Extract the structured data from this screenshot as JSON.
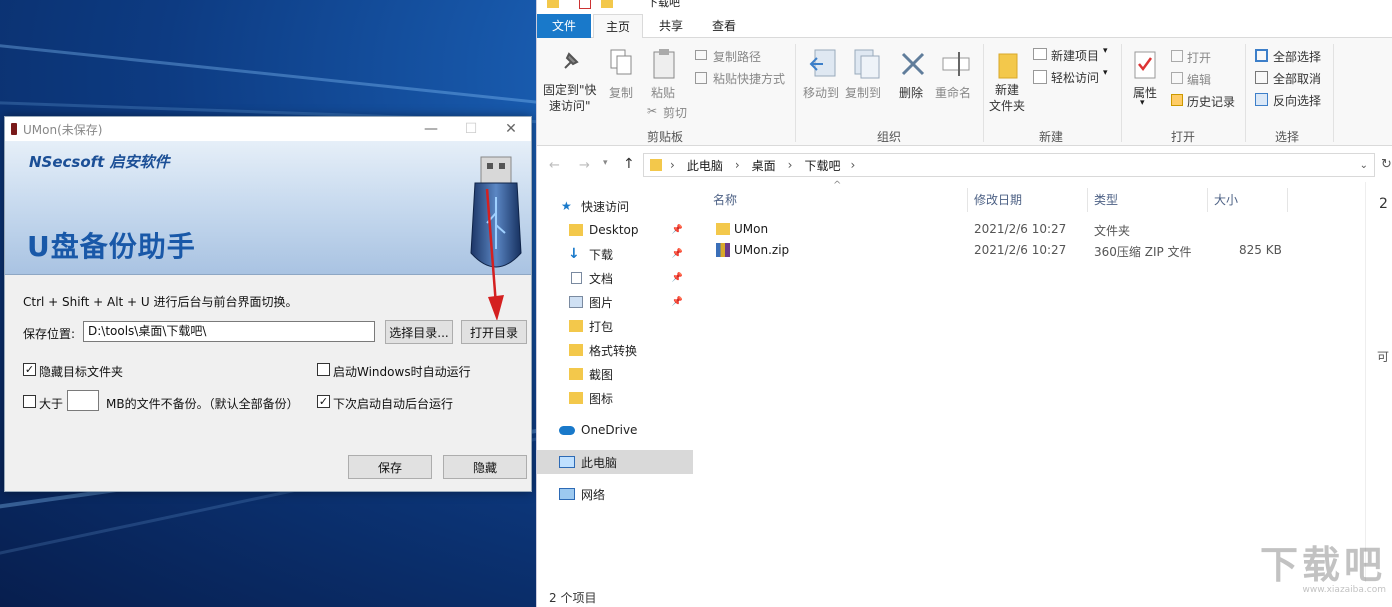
{
  "umon": {
    "title": "UMon(未保存)",
    "brand": "NSecsoft 启安软件",
    "banner_title": "U盘备份助手",
    "hint": "Ctrl + Shift + Alt + U 进行后台与前台界面切换。",
    "save_location_label": "保存位置:",
    "save_location_value": "D:\\tools\\桌面\\下载吧\\",
    "choose_dir_button": "选择目录...",
    "open_dir_button": "打开目录",
    "hide_folder_label": "隐藏目标文件夹",
    "hide_folder_checked": "✓",
    "autostart_label": "启动Windows时自动运行",
    "size_prefix": "大于",
    "size_value": "",
    "size_suffix": "MB的文件不备份。（默认全部备份）",
    "bg_run_label": "下次启动自动后台运行",
    "bg_run_checked": "✓",
    "save_button": "保存",
    "hide_button": "隐藏",
    "minimize": "—",
    "maximize": "☐",
    "close": "✕"
  },
  "explorer": {
    "qat_title": "下载吧",
    "tabs": [
      "文件",
      "主页",
      "共享",
      "查看"
    ],
    "ribbon": {
      "pin_quick": "固定到\"快\n速访问\"",
      "copy": "复制",
      "paste": "粘贴",
      "copy_path": "复制路径",
      "paste_shortcut": "粘贴快捷方式",
      "cut": "剪切",
      "group_clipboard": "剪贴板",
      "move_to": "移动到",
      "copy_to": "复制到",
      "delete": "删除",
      "rename": "重命名",
      "group_organize": "组织",
      "new_folder": "新建\n文件夹",
      "new_item": "新建项目",
      "easy_access": "轻松访问",
      "group_new": "新建",
      "properties": "属性",
      "open": "打开",
      "edit": "编辑",
      "history": "历史记录",
      "group_open": "打开",
      "select_all": "全部选择",
      "select_none": "全部取消",
      "invert_select": "反向选择",
      "group_select": "选择"
    },
    "breadcrumb": [
      "此电脑",
      "桌面",
      "下载吧"
    ],
    "nav": [
      {
        "label": "快速访问",
        "pinned": ""
      },
      {
        "label": "Desktop",
        "pinned": "📌"
      },
      {
        "label": "下载",
        "pinned": "📌"
      },
      {
        "label": "文档",
        "pinned": "📌"
      },
      {
        "label": "图片",
        "pinned": "📌"
      },
      {
        "label": "打包",
        "pinned": ""
      },
      {
        "label": "格式转换",
        "pinned": ""
      },
      {
        "label": "截图",
        "pinned": ""
      },
      {
        "label": "图标",
        "pinned": ""
      },
      {
        "label": "OneDrive",
        "pinned": ""
      },
      {
        "label": "此电脑",
        "pinned": ""
      },
      {
        "label": "网络",
        "pinned": ""
      }
    ],
    "columns": [
      "名称",
      "修改日期",
      "类型",
      "大小"
    ],
    "files": [
      {
        "name": "UMon",
        "date": "2021/2/6 10:27",
        "type": "文件夹",
        "size": ""
      },
      {
        "name": "UMon.zip",
        "date": "2021/2/6 10:27",
        "type": "360压缩 ZIP 文件",
        "size": "825 KB"
      }
    ],
    "preview_edge": "2",
    "preview_edge2": "可",
    "status": "2 个项目"
  },
  "watermark": {
    "text": "下载吧",
    "url": "www.xiazaiba.com"
  },
  "colors": {
    "accent": "#1979ca",
    "arrow": "#d42020"
  }
}
